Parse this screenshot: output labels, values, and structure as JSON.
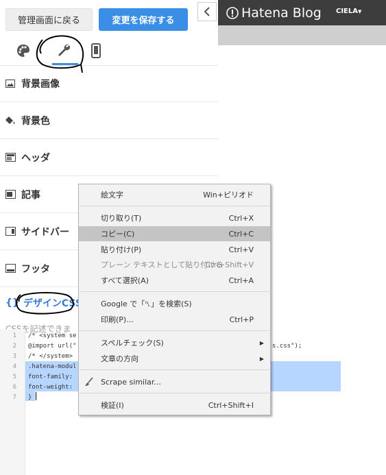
{
  "left_panel": {
    "back_button": "管理画面に戻る",
    "save_button": "変更を保存する",
    "tabs": [
      {
        "name": "design",
        "icon": "palette-icon"
      },
      {
        "name": "customize",
        "icon": "wrench-icon"
      },
      {
        "name": "smartphone",
        "icon": "smartphone-icon"
      }
    ],
    "sections": [
      {
        "label": "背景画像",
        "icon": "image-icon"
      },
      {
        "label": "背景色",
        "icon": "paint-bucket-icon"
      },
      {
        "label": "ヘッダ",
        "icon": "layout-header-icon"
      },
      {
        "label": "記事",
        "icon": "layout-article-icon"
      },
      {
        "label": "サイドバー",
        "icon": "layout-sidebar-icon"
      },
      {
        "label": "フッタ",
        "icon": "layout-footer-icon"
      }
    ],
    "css_section": {
      "icon_text": "{}",
      "label": "デザインCSS",
      "description": "CSSを記述できま"
    }
  },
  "editor": {
    "line_numbers": [
      "1",
      "2",
      "3",
      "4",
      "5",
      "6",
      "7"
    ],
    "lines": [
      "/* <system se",
      "@import url(\"",
      "/* </system>",
      ".hatena-modul",
      "font-family:",
      "font-weight:",
      "}"
    ],
    "line2_tail": "s.css\");"
  },
  "preview": {
    "logo_text": "Hatena Blog",
    "user": "CIELA"
  },
  "context_menu": {
    "items": [
      {
        "label": "絵文字",
        "shortcut": "Win+ピリオド"
      },
      {
        "label": "切り取り(T)",
        "shortcut": "Ctrl+X"
      },
      {
        "label": "コピー(C)",
        "shortcut": "Ctrl+C",
        "highlighted": true
      },
      {
        "label": "貼り付け(P)",
        "shortcut": "Ctrl+V"
      },
      {
        "label": "プレーン テキストとして貼り付ける",
        "shortcut": "Ctrl+Shift+V",
        "disabled": true
      },
      {
        "label": "すべて選択(A)",
        "shortcut": "Ctrl+A"
      },
      {
        "label": "Google で「␤」を検索(S)",
        "shortcut": ""
      },
      {
        "label": "印刷(P)...",
        "shortcut": "Ctrl+P"
      },
      {
        "label": "スペルチェック(S)",
        "shortcut": "",
        "submenu": true
      },
      {
        "label": "文章の方向",
        "shortcut": "",
        "submenu": true
      },
      {
        "label": "Scrape similar...",
        "shortcut": "",
        "icon": "brush-icon"
      },
      {
        "label": "検証(I)",
        "shortcut": "Ctrl+Shift+I"
      }
    ]
  },
  "colors": {
    "accent": "#3a8ee6",
    "topbar": "#3d3d3d",
    "selection": "#b7d6ff"
  }
}
